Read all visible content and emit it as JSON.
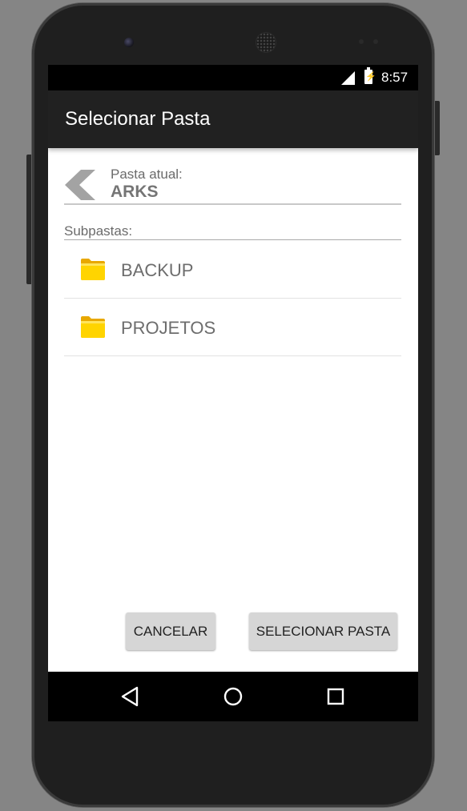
{
  "status_bar": {
    "time": "8:57"
  },
  "app_bar": {
    "title": "Selecionar Pasta"
  },
  "current_folder": {
    "label": "Pasta atual:",
    "name": "ARKS"
  },
  "subfolders": {
    "label": "Subpastas:",
    "items": [
      {
        "name": "BACKUP",
        "icon": "folder-icon"
      },
      {
        "name": "PROJETOS",
        "icon": "folder-icon"
      }
    ]
  },
  "actions": {
    "cancel_label": "CANCELAR",
    "select_label": "SELECIONAR PASTA"
  },
  "nav_bar": {
    "icons": [
      "back-triangle-icon",
      "home-circle-icon",
      "recents-square-icon"
    ]
  },
  "colors": {
    "app_bar": "#212121",
    "folder": "#ffd200",
    "button_bg": "#d6d6d6"
  }
}
